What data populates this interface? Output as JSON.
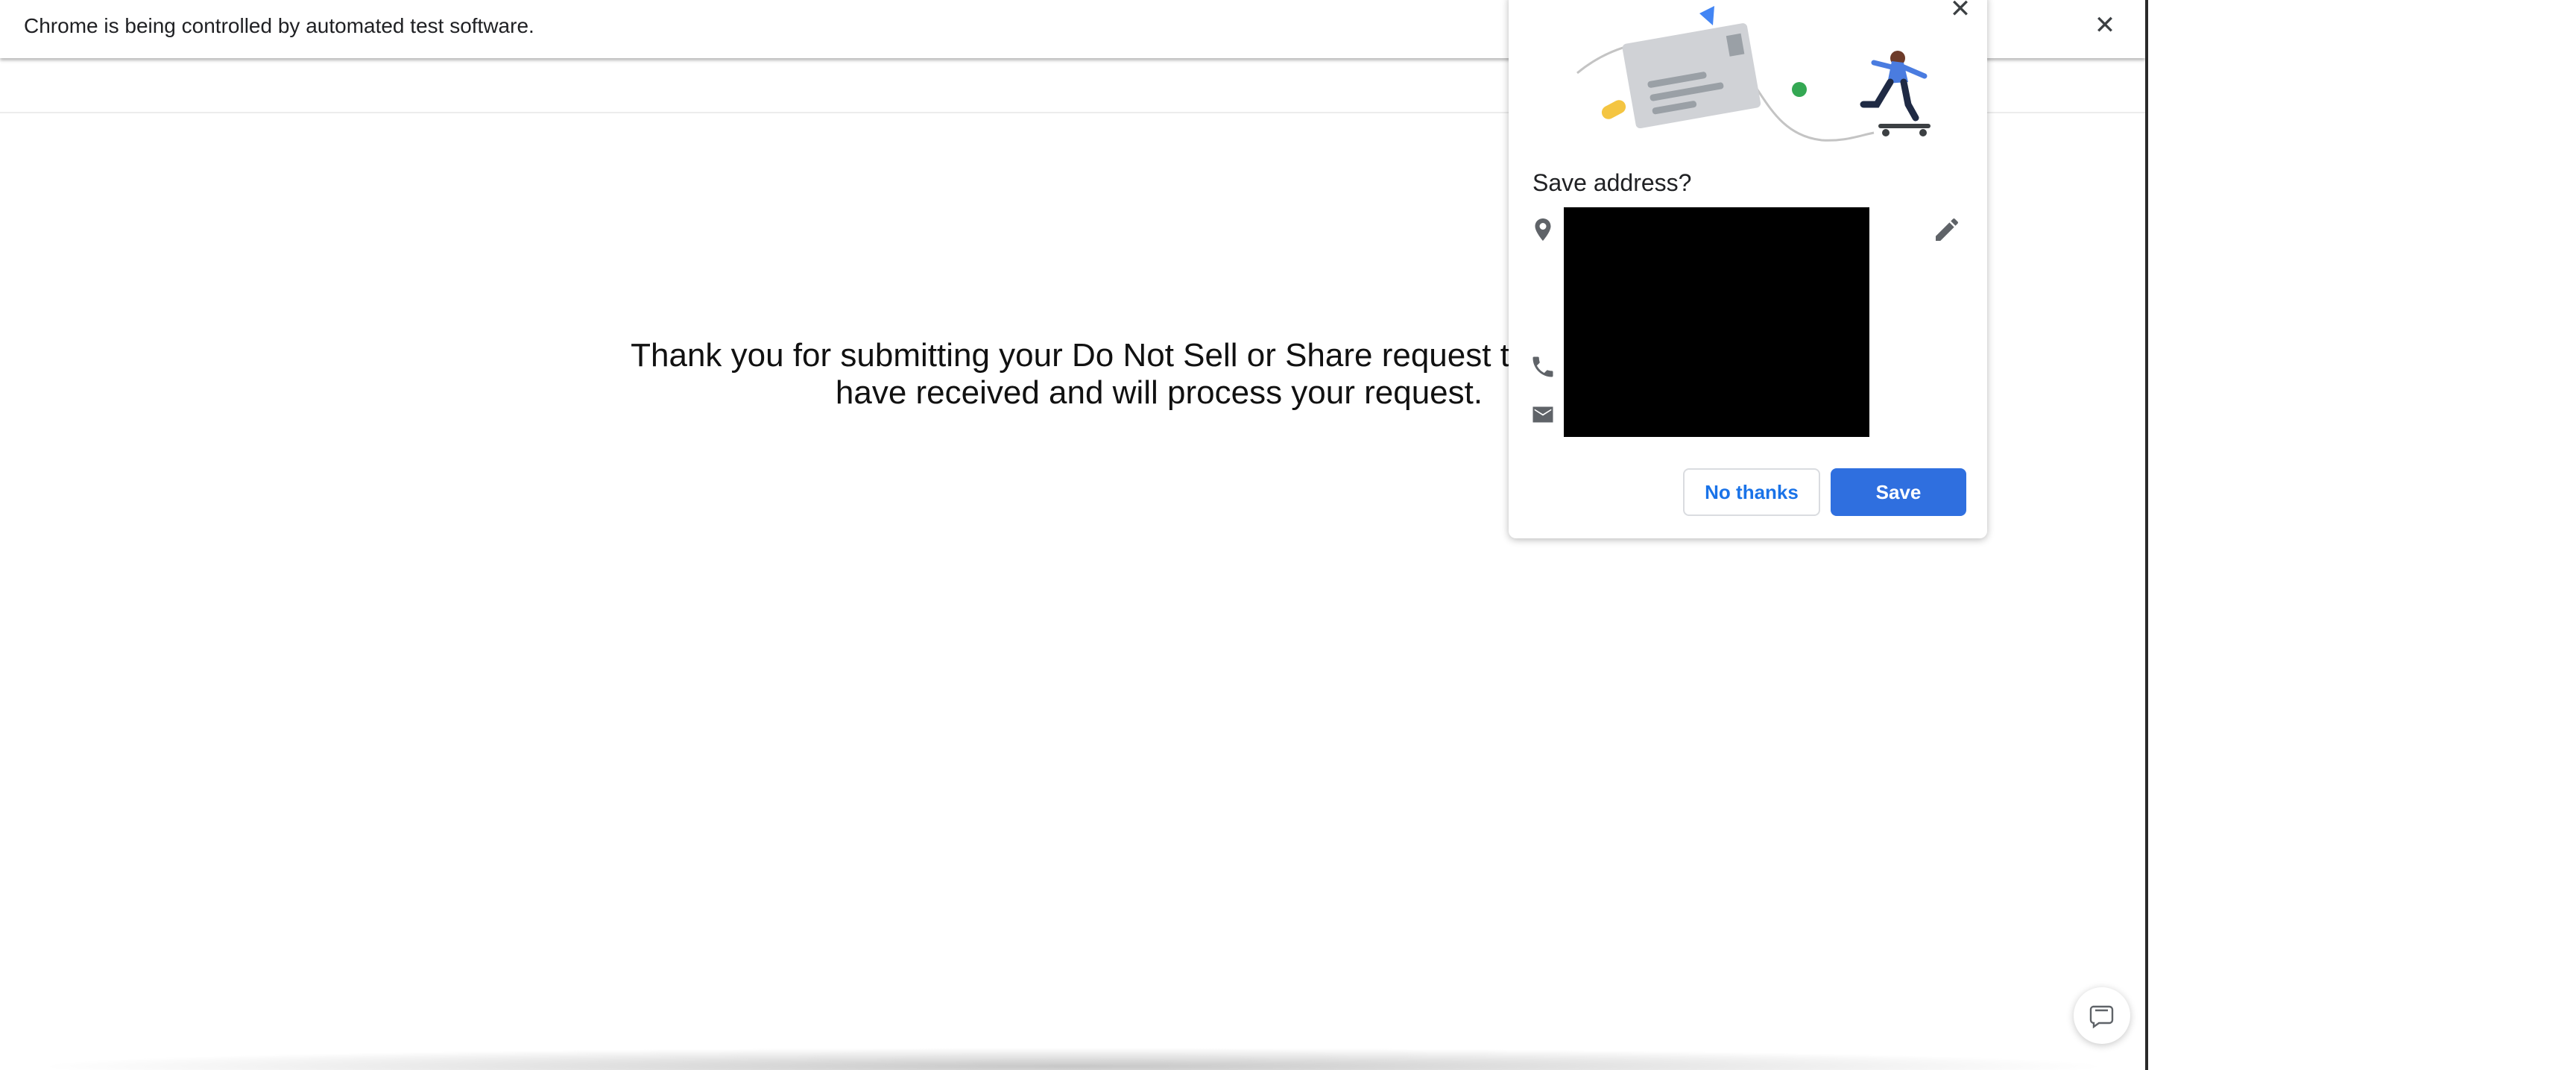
{
  "infobar": {
    "message": "Chrome is being controlled by automated test software."
  },
  "page": {
    "thank_you_line1": "Thank you for submitting your Do Not Sell or Share request to the Tapest",
    "thank_you_line2": "have received and will process your request."
  },
  "popup": {
    "title": "Save address?",
    "no_thanks_label": "No thanks",
    "save_label": "Save"
  },
  "icons": {
    "infobar_close": "close-icon",
    "popup_close": "close-icon",
    "location": "location-pin-icon",
    "phone": "phone-icon",
    "email": "email-icon",
    "edit": "pencil-icon",
    "chat": "chat-icon"
  },
  "colors": {
    "primary_blue": "#2f6fdf",
    "link_blue": "#1a73e8",
    "icon_gray": "#5f6368"
  }
}
